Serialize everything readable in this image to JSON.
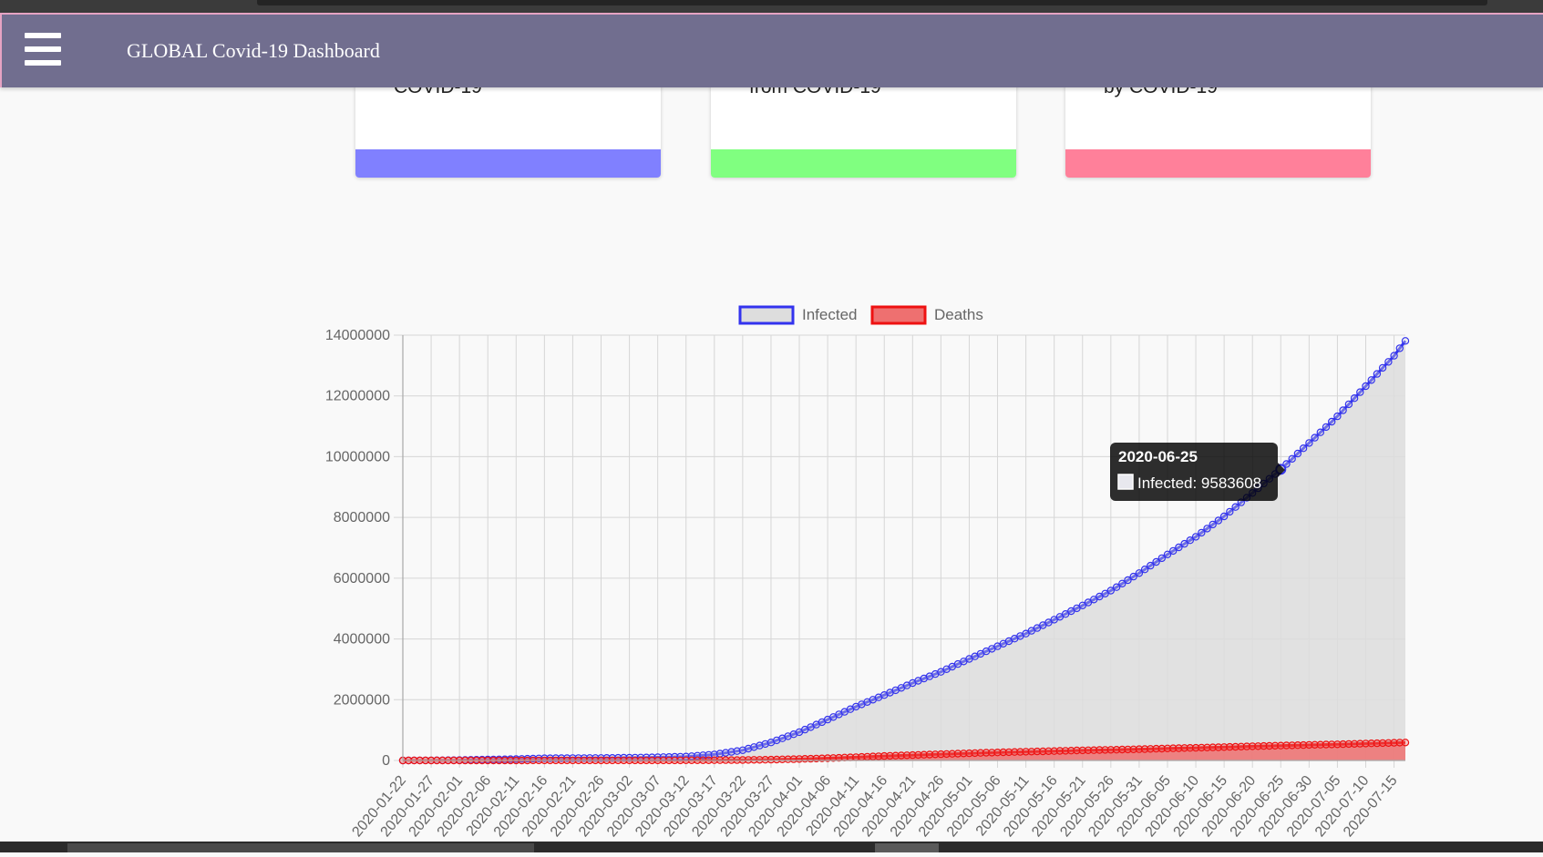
{
  "app": {
    "title": "GLOBAL Covid-19 Dashboard",
    "menu_icon": "hamburger-menu-icon"
  },
  "cards": [
    {
      "text": "COVID-19",
      "bar_color": "#8080ff"
    },
    {
      "text": "from COVID-19",
      "bar_color": "#80ff80"
    },
    {
      "text": "by COVID-19",
      "bar_color": "#ff809a"
    }
  ],
  "chart_data": {
    "type": "line",
    "x_start": "2020-01-22",
    "x_end": "2020-07-17",
    "x_tick_labels": [
      "2020-01-22",
      "2020-01-27",
      "2020-02-01",
      "2020-02-06",
      "2020-02-11",
      "2020-02-16",
      "2020-02-21",
      "2020-02-26",
      "2020-03-02",
      "2020-03-07",
      "2020-03-12",
      "2020-03-17",
      "2020-03-22",
      "2020-03-27",
      "2020-04-01",
      "2020-04-06",
      "2020-04-11",
      "2020-04-16",
      "2020-04-21",
      "2020-04-26",
      "2020-05-01",
      "2020-05-06",
      "2020-05-11",
      "2020-05-16",
      "2020-05-21",
      "2020-05-26",
      "2020-05-31",
      "2020-06-05",
      "2020-06-10",
      "2020-06-15",
      "2020-06-20",
      "2020-06-25",
      "2020-06-30",
      "2020-07-05",
      "2020-07-10",
      "2020-07-15"
    ],
    "ylim": [
      0,
      14000000
    ],
    "y_tick_labels": [
      "0",
      "2000000",
      "4000000",
      "6000000",
      "8000000",
      "10000000",
      "12000000",
      "14000000"
    ],
    "grid": true,
    "legend_position": "top-center",
    "series": [
      {
        "name": "Infected",
        "border_color": "#3333ee",
        "fill_color": "#dddddd",
        "points": [
          [
            "2020-01-22",
            555
          ],
          [
            "2020-01-27",
            2927
          ],
          [
            "2020-02-01",
            12038
          ],
          [
            "2020-02-06",
            30818
          ],
          [
            "2020-02-11",
            45170
          ],
          [
            "2020-02-16",
            71226
          ],
          [
            "2020-02-21",
            76843
          ],
          [
            "2020-02-26",
            81397
          ],
          [
            "2020-03-02",
            90306
          ],
          [
            "2020-03-07",
            105836
          ],
          [
            "2020-03-12",
            128343
          ],
          [
            "2020-03-17",
            197102
          ],
          [
            "2020-03-22",
            337020
          ],
          [
            "2020-03-27",
            593291
          ],
          [
            "2020-04-01",
            932605
          ],
          [
            "2020-04-06",
            1346004
          ],
          [
            "2020-04-11",
            1771514
          ],
          [
            "2020-04-16",
            2152647
          ],
          [
            "2020-04-21",
            2549294
          ],
          [
            "2020-04-26",
            2917562
          ],
          [
            "2020-05-01",
            3343777
          ],
          [
            "2020-05-06",
            3759963
          ],
          [
            "2020-05-11",
            4177502
          ],
          [
            "2020-05-16",
            4634068
          ],
          [
            "2020-05-21",
            5102424
          ],
          [
            "2020-05-26",
            5589626
          ],
          [
            "2020-05-31",
            6166946
          ],
          [
            "2020-06-05",
            6782011
          ],
          [
            "2020-06-10",
            7364104
          ],
          [
            "2020-06-15",
            8034461
          ],
          [
            "2020-06-20",
            8803335
          ],
          [
            "2020-06-25",
            9583608
          ],
          [
            "2020-06-30",
            10449697
          ],
          [
            "2020-07-05",
            11327790
          ],
          [
            "2020-07-10",
            12322395
          ],
          [
            "2020-07-15",
            13323000
          ],
          [
            "2020-07-17",
            13812525
          ]
        ]
      },
      {
        "name": "Deaths",
        "border_color": "#ee1111",
        "fill_color": "#ee7070",
        "points": [
          [
            "2020-01-22",
            17
          ],
          [
            "2020-01-27",
            82
          ],
          [
            "2020-02-01",
            259
          ],
          [
            "2020-02-06",
            636
          ],
          [
            "2020-02-11",
            1118
          ],
          [
            "2020-02-16",
            1770
          ],
          [
            "2020-02-21",
            2251
          ],
          [
            "2020-02-26",
            2770
          ],
          [
            "2020-03-02",
            3085
          ],
          [
            "2020-03-07",
            3558
          ],
          [
            "2020-03-12",
            4720
          ],
          [
            "2020-03-17",
            7905
          ],
          [
            "2020-03-22",
            14611
          ],
          [
            "2020-03-27",
            27198
          ],
          [
            "2020-04-01",
            47180
          ],
          [
            "2020-04-06",
            74565
          ],
          [
            "2020-04-11",
            108505
          ],
          [
            "2020-04-16",
            145521
          ],
          [
            "2020-04-21",
            177641
          ],
          [
            "2020-04-26",
            206544
          ],
          [
            "2020-05-01",
            237652
          ],
          [
            "2020-05-06",
            263830
          ],
          [
            "2020-05-11",
            286330
          ],
          [
            "2020-05-16",
            310000
          ],
          [
            "2020-05-21",
            332924
          ],
          [
            "2020-05-26",
            350453
          ],
          [
            "2020-05-31",
            370500
          ],
          [
            "2020-06-05",
            395945
          ],
          [
            "2020-06-10",
            418127
          ],
          [
            "2020-06-15",
            440290
          ],
          [
            "2020-06-20",
            466210
          ],
          [
            "2020-06-25",
            489312
          ],
          [
            "2020-06-30",
            511210
          ],
          [
            "2020-07-05",
            531806
          ],
          [
            "2020-07-10",
            557280
          ],
          [
            "2020-07-15",
            582000
          ],
          [
            "2020-07-17",
            591000
          ]
        ]
      }
    ],
    "tooltip": {
      "date": "2020-06-25",
      "label": "Infected: 9583608",
      "series": "Infected",
      "value": 9583608
    }
  }
}
